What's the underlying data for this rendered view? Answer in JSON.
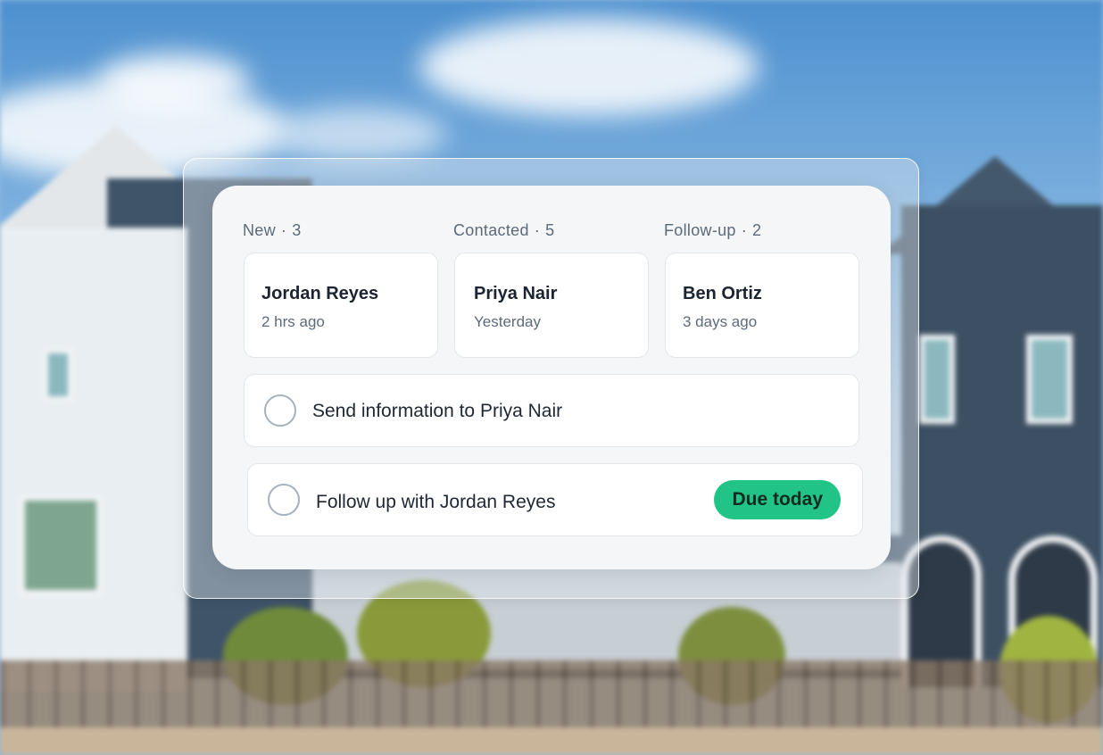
{
  "columns": [
    {
      "label": "New",
      "count": "3"
    },
    {
      "label": "Contacted",
      "count": "5"
    },
    {
      "label": "Follow-up",
      "count": "2"
    }
  ],
  "leads": [
    {
      "name": "Jordan Reyes",
      "time": "2 hrs ago"
    },
    {
      "name": "Priya Nair",
      "time": "Yesterday"
    },
    {
      "name": "Ben Ortiz",
      "time": "3 days ago"
    }
  ],
  "tasks": [
    {
      "label": "Send information to Priya Nair",
      "badge": ""
    },
    {
      "label": "Follow up with Jordan Reyes",
      "badge": "Due today"
    }
  ],
  "colors": {
    "badge": "#21c486",
    "card_bg": "#f4f6f8",
    "text_primary": "#1b2430",
    "text_secondary": "#5d6b79"
  }
}
